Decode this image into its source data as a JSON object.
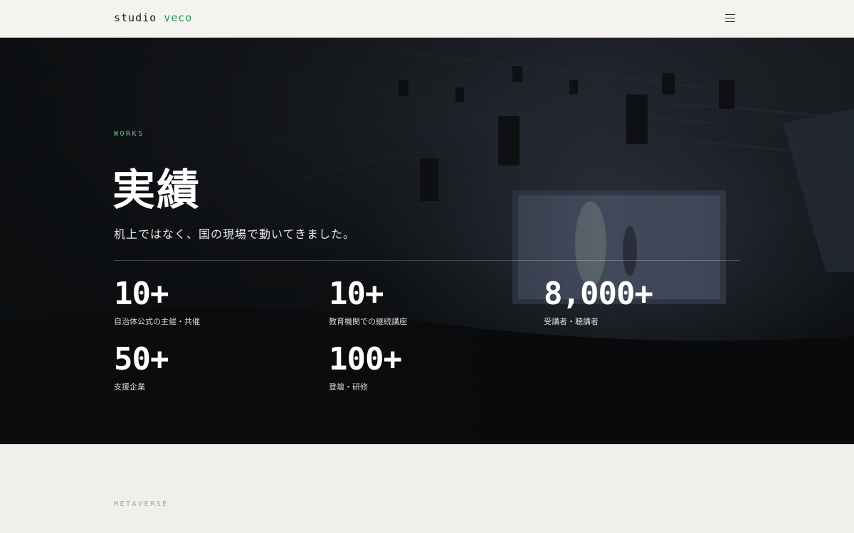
{
  "header": {
    "logo_main": "studio ",
    "logo_accent": "veco",
    "menu_icon": "hamburger-menu-icon"
  },
  "hero": {
    "eyebrow": "WORKS",
    "title": "実績",
    "subtitle": "机上ではなく、国の現場で動いてきました。",
    "stats": [
      {
        "value": "10+",
        "label": "自治体公式の主催・共催"
      },
      {
        "value": "10+",
        "label": "教育機関での継続講座"
      },
      {
        "value": "8,000+",
        "label": "受講者・聴講者"
      },
      {
        "value": "50+",
        "label": "支援企業"
      },
      {
        "value": "100+",
        "label": "登壇・研修"
      }
    ]
  },
  "metaverse": {
    "eyebrow": "METAVERSE"
  },
  "colors": {
    "accent": "#1f9a57",
    "eyebrow": "#6fbf93",
    "hero_text": "#ffffff",
    "page_bg": "#f1efea"
  }
}
